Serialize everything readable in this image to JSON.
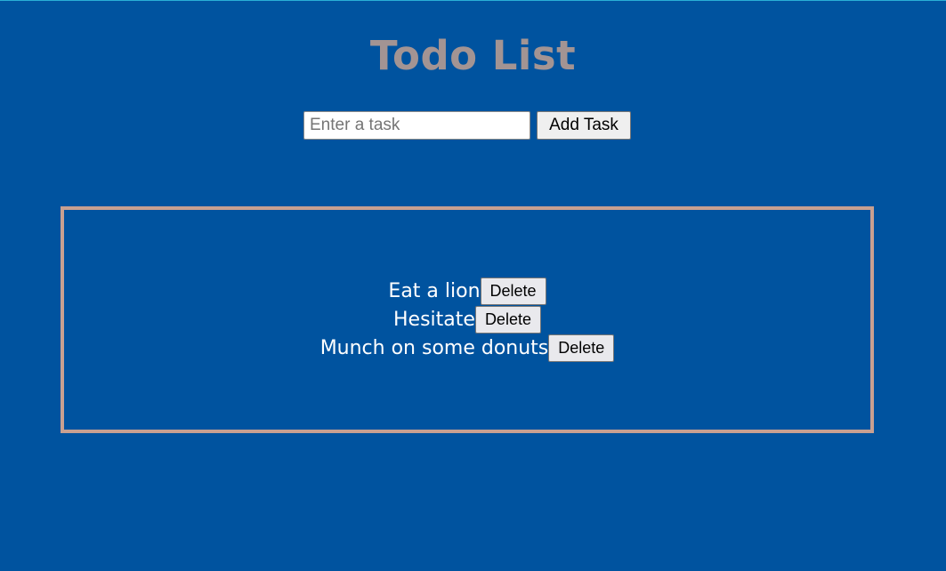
{
  "header": {
    "title": "Todo List"
  },
  "add_form": {
    "input_value": "",
    "input_placeholder": "Enter a task",
    "add_button_label": "Add Task"
  },
  "tasks": [
    {
      "text": "Eat a lion",
      "delete_label": "Delete"
    },
    {
      "text": "Hesitate",
      "delete_label": "Delete"
    },
    {
      "text": "Munch on some donuts",
      "delete_label": "Delete"
    }
  ],
  "colors": {
    "background": "#00539f",
    "title": "#a39493",
    "box_border": "#c8a091",
    "task_text": "#ffffff"
  }
}
